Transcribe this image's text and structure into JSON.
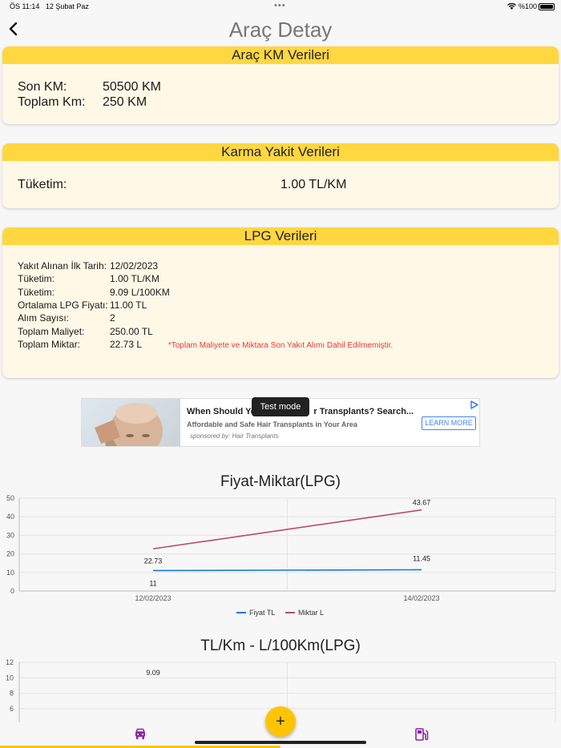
{
  "status_bar": {
    "time": "ÖS 11:14",
    "date": "12 Şubat Paz",
    "dots": "•••",
    "battery": "%100"
  },
  "nav": {
    "back_icon": "chevron-left-icon",
    "title": "Araç Detay"
  },
  "km_card": {
    "title": "Araç KM Verileri",
    "rows": [
      {
        "label": "Son KM:",
        "value": "50500 KM"
      },
      {
        "label": "Toplam Km:",
        "value": "250 KM"
      }
    ]
  },
  "mixed_card": {
    "title": "Karma Yakit Verileri",
    "label": "Tüketim:",
    "value": "1.00 TL/KM"
  },
  "lpg_card": {
    "title": "LPG Verileri",
    "rows": [
      {
        "label": "Yakıt Alınan İlk Tarih:",
        "value": "12/02/2023"
      },
      {
        "label": "Tüketim:",
        "value": "1.00 TL/KM"
      },
      {
        "label": "Tüketim:",
        "value": "9.09 L/100KM"
      },
      {
        "label": "Ortalama LPG Fiyatı:",
        "value": "11.00 TL"
      },
      {
        "label": "Alım Sayısı:",
        "value": "2"
      },
      {
        "label": "Toplam Maliyet:",
        "value": "250.00 TL"
      },
      {
        "label": "Toplam Miktar:",
        "value": "22.73 L"
      }
    ],
    "note": "*Toplam Maliyete ve Miktara Son Yakıt Alımı Dahil Edilmemiştir."
  },
  "ad": {
    "title": "When Should Yo",
    "title_rest": "r Transplants? Search...",
    "subtitle": "Affordable and Safe Hair Transplants in Your Area",
    "sponsor": "sponsored by: Hair Transplants",
    "cta": "LEARN MORE",
    "badge": "Test mode",
    "choice_icon": "adchoices-icon"
  },
  "chart_data": [
    {
      "type": "line",
      "title": "Fiyat-Miktar(LPG)",
      "x": [
        "12/02/2023",
        "14/02/2023"
      ],
      "ylim": [
        0,
        50
      ],
      "yticks": [
        "0",
        "10",
        "20",
        "30",
        "40",
        "50"
      ],
      "grid": true,
      "legend": "bottom",
      "series": [
        {
          "name": "Fiyat TL",
          "color": "#1976d2",
          "values": [
            11,
            11.45
          ],
          "labels": [
            "11",
            "11.45"
          ]
        },
        {
          "name": "Miktar L",
          "color": "#b94a6b",
          "values": [
            22.73,
            43.67
          ],
          "labels": [
            "22.73",
            "43.67"
          ]
        }
      ]
    },
    {
      "type": "line",
      "title": "TL/Km - L/100Km(LPG)",
      "yticks": [
        "6",
        "8",
        "10",
        "12"
      ],
      "grid": true,
      "data_labels": [
        "9.09"
      ]
    }
  ],
  "bottom_bar": {
    "fab_label": "+",
    "fab_icon": "plus-icon",
    "left_icon": "car-icon",
    "right_icon": "fuel-pump-icon"
  }
}
